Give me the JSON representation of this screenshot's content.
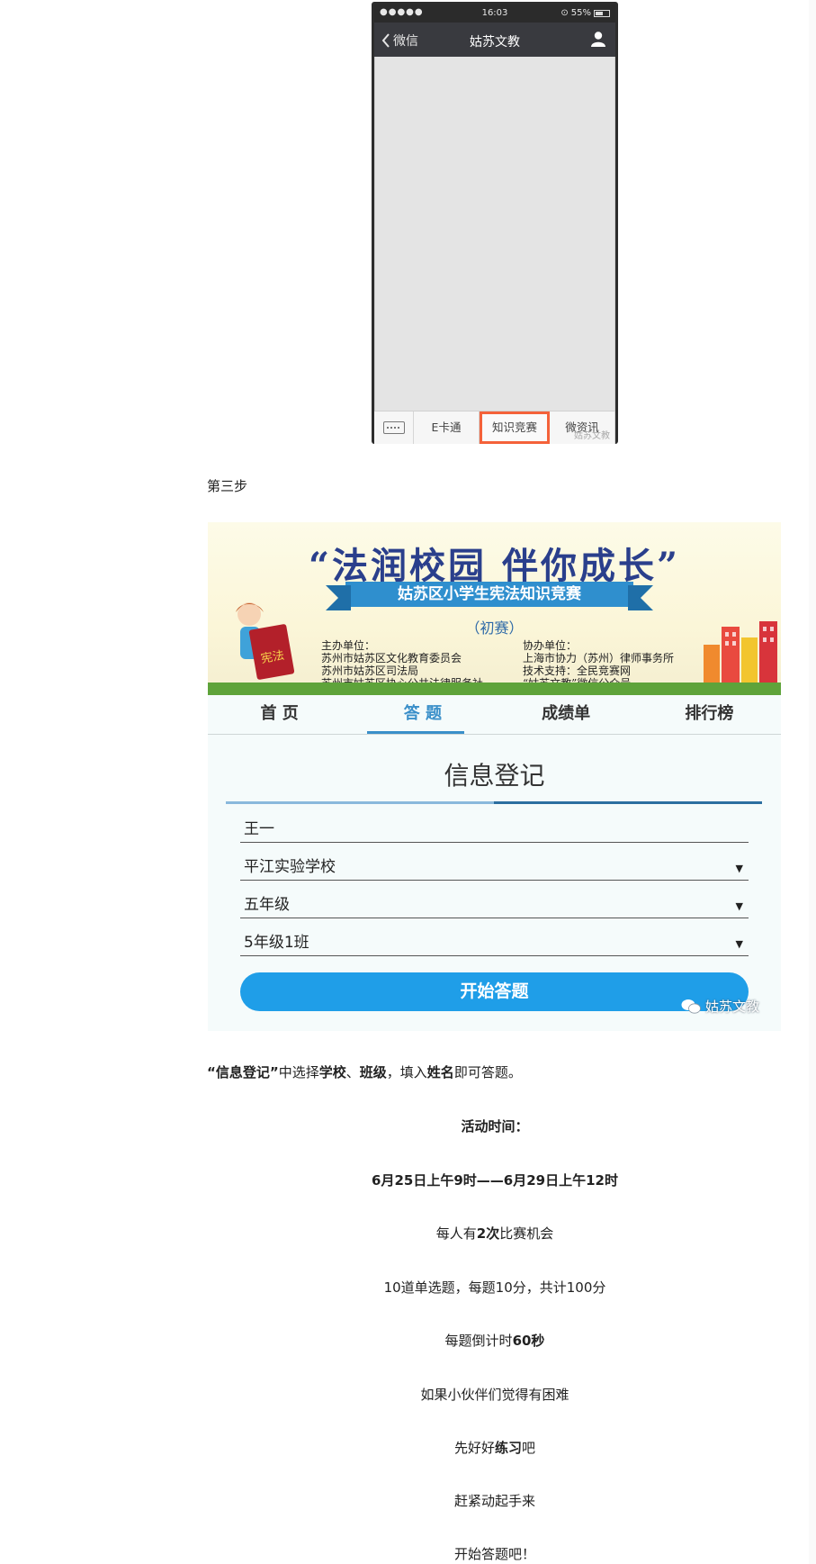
{
  "phone": {
    "status": {
      "signal": "●●●●●",
      "time": "16:03",
      "battery": "55%"
    },
    "title": "姑苏文教",
    "back_label": "微信",
    "menu": [
      "E卡通",
      "知识竞赛",
      "微资讯"
    ],
    "watermark": "姑苏文教"
  },
  "step_label": "第三步",
  "quiz": {
    "banner": {
      "title": "“法润校园 伴你成长”",
      "subtitle": "姑苏区小学生宪法知识竞赛",
      "round": "（初赛）",
      "book_label": "宪法",
      "organizers_left": [
        "主办单位：",
        "苏州市姑苏区文化教育委员会",
        "苏州市姑苏区司法局",
        "苏州市姑苏区协心公共法律服务社"
      ],
      "organizers_right": [
        "协办单位：",
        "上海市协力（苏州）律师事务所",
        "技术支持：全民竞赛网",
        "“姑苏文教”微信公众号"
      ]
    },
    "tabs": [
      "首 页",
      "答 题",
      "成绩单",
      "排行榜"
    ],
    "form_title": "信息登记",
    "fields": {
      "name": "王一",
      "school": "平江实验学校",
      "grade": "五年级",
      "class": "5年级1班"
    },
    "dropdown_arrow": "▼",
    "start_button": "开始答题",
    "watermark": "姑苏文教"
  },
  "intro": {
    "p1": "“信息登记”",
    "p2": "中选择",
    "p3": "学校",
    "p4": "、",
    "p5": "班级",
    "p6": "，填入",
    "p7": "姓名",
    "p8": "即可答题。"
  },
  "lines": {
    "l1": "活动时间：",
    "l2": "6月25日上午9时——6月29日上午12时",
    "l3a": "每人有",
    "l3b": "2次",
    "l3c": "比赛机会",
    "l4": "10道单选题，每题10分，共计100分",
    "l5a": "每题倒计时",
    "l5b": "60秒",
    "l6": "如果小伙伴们觉得有困难",
    "l7a": "先好好",
    "l7b": "练习",
    "l7c": "吧",
    "l8": "赶紧动起手来",
    "l9": "开始答题吧！"
  }
}
